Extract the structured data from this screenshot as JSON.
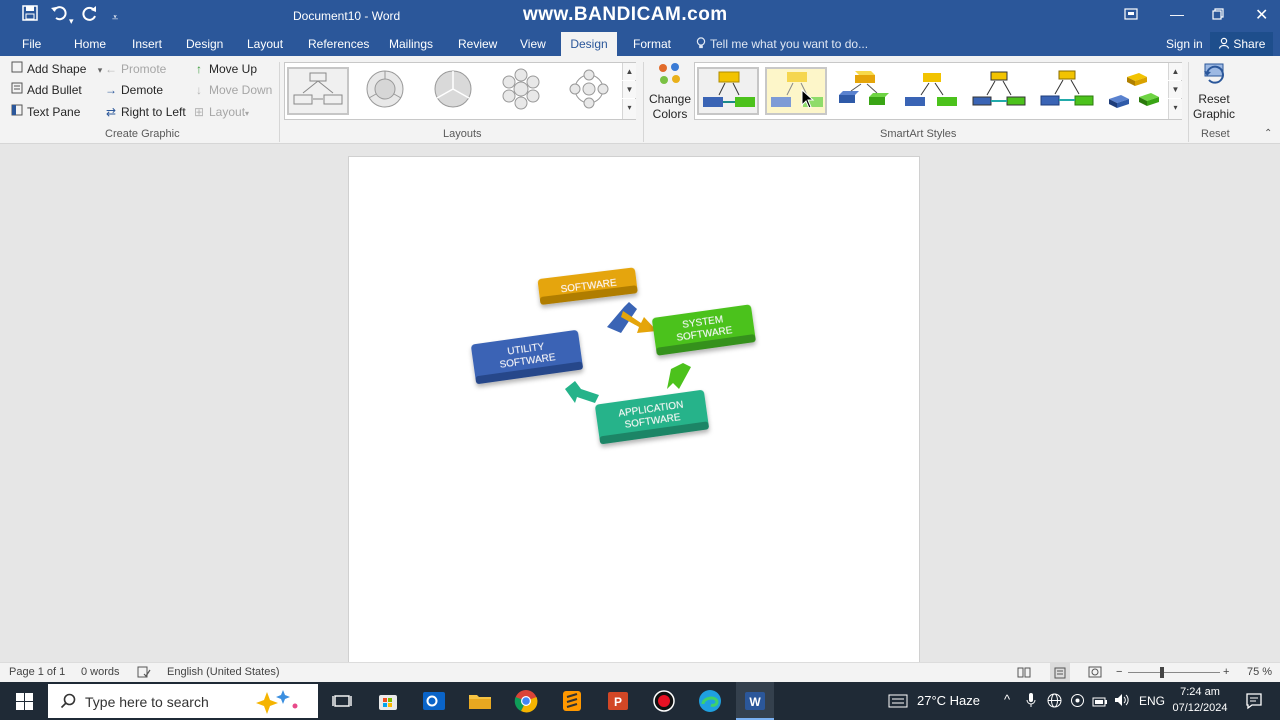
{
  "titlebar": {
    "document_title": "Document10 - Word",
    "watermark": "www.BANDICAM.com"
  },
  "tabs": [
    "File",
    "Home",
    "Insert",
    "Design",
    "Layout",
    "References",
    "Mailings",
    "Review",
    "View",
    "Design",
    "Format"
  ],
  "active_tab_index": 9,
  "tell_me": "Tell me what you want to do...",
  "account": {
    "sign_in": "Sign in",
    "share": "Share"
  },
  "ribbon": {
    "create_graphic": {
      "label": "Create Graphic",
      "add_shape": "Add Shape",
      "add_bullet": "Add Bullet",
      "text_pane": "Text Pane",
      "promote": "Promote",
      "demote": "Demote",
      "right_to_left": "Right to Left",
      "move_up": "Move Up",
      "move_down": "Move Down",
      "layout": "Layout"
    },
    "layouts": {
      "label": "Layouts"
    },
    "change_colors": {
      "line1": "Change",
      "line2": "Colors"
    },
    "smartart_styles": {
      "label": "SmartArt Styles",
      "selected_index": 0,
      "hover_index": 1
    },
    "reset": {
      "line1": "Reset",
      "line2": "Graphic",
      "label": "Reset"
    }
  },
  "diagram": {
    "nodes": [
      {
        "line1": "SOFTWARE",
        "line2": "",
        "color": "#e5a50a"
      },
      {
        "line1": "SYSTEM",
        "line2": "SOFTWARE",
        "color": "#4cc21c"
      },
      {
        "line1": "APPLICATION",
        "line2": "SOFTWARE",
        "color": "#25b38a"
      },
      {
        "line1": "UTILITY",
        "line2": "SOFTWARE",
        "color": "#3a64b5"
      }
    ]
  },
  "statusbar": {
    "page": "Page 1 of 1",
    "words": "0 words",
    "language": "English (United States)",
    "zoom": "75 %"
  },
  "taskbar": {
    "search_placeholder": "Type here to search",
    "weather": "27°C  Haze",
    "language": "ENG",
    "time": "7:24 am",
    "date": "07/12/2024"
  },
  "colors": {
    "word_blue": "#2b579a",
    "ribbon_bg": "#f3f3f3",
    "taskbar_bg": "#1f2a36"
  }
}
